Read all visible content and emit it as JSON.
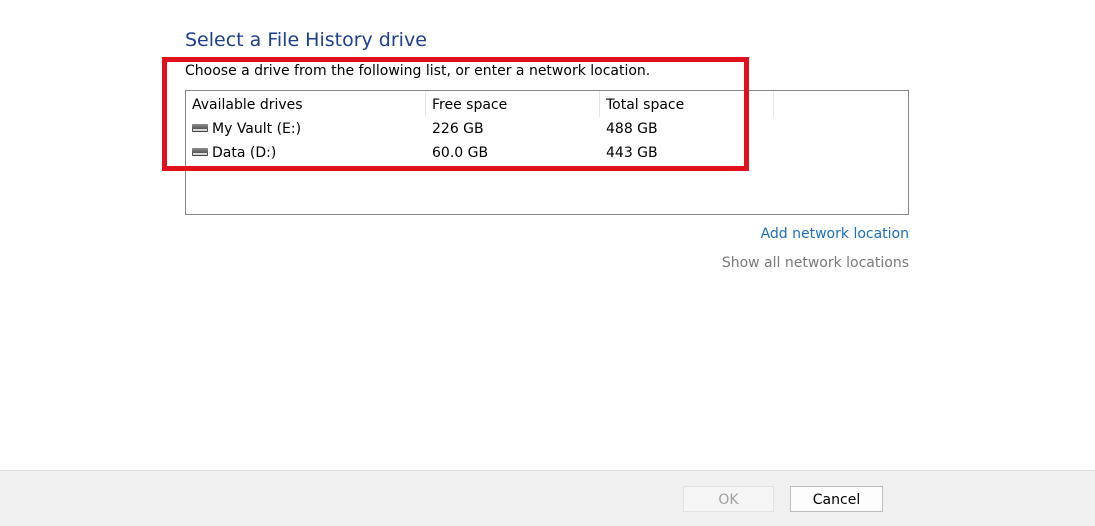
{
  "dialog": {
    "title": "Select a File History drive",
    "instruction": "Choose a drive from the following list, or enter a network location."
  },
  "drives_list": {
    "columns": [
      "Available drives",
      "Free space",
      "Total space"
    ],
    "rows": [
      {
        "icon": "drive-icon",
        "name": "My Vault (E:)",
        "free": "226 GB",
        "total": "488 GB"
      },
      {
        "icon": "drive-icon",
        "name": "Data (D:)",
        "free": "60.0 GB",
        "total": "443 GB"
      }
    ]
  },
  "links": {
    "add_network_location": "Add network location",
    "show_all_network_locations": "Show all network locations"
  },
  "buttons": {
    "ok": "OK",
    "cancel": "Cancel"
  },
  "colors": {
    "title": "#1e3f8c",
    "link": "#1a6fbf",
    "highlight_box": "#e0101c"
  }
}
